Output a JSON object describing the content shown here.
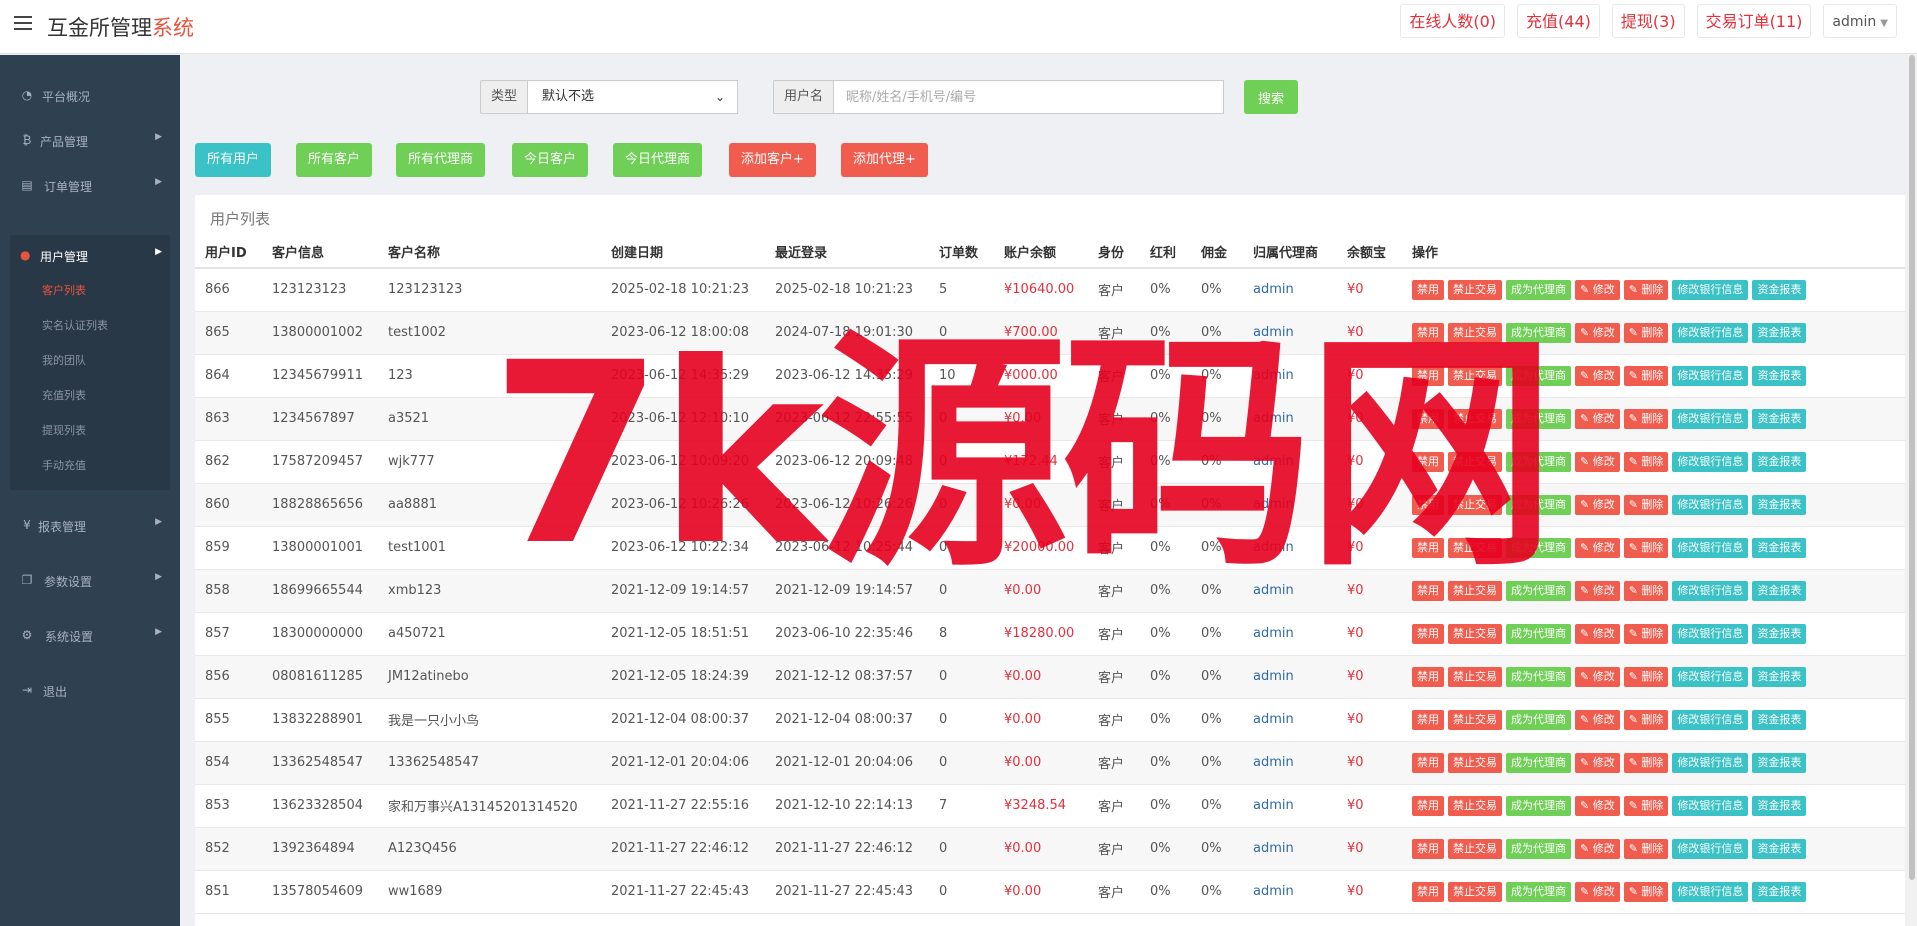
{
  "brand": {
    "title": "互金所管理",
    "accent": "系统"
  },
  "topbar": {
    "badges": [
      "在线人数(0)",
      "充值(44)",
      "提现(3)",
      "交易订单(11)"
    ],
    "user": "admin"
  },
  "sidebar": {
    "items": [
      {
        "label": "平台概况",
        "icon": "dashboard-icon"
      },
      {
        "label": "产品管理",
        "icon": "bitcoin-icon"
      },
      {
        "label": "订单管理",
        "icon": "orders-icon"
      },
      {
        "label": "用户管理",
        "icon": "user-icon"
      },
      {
        "label": "报表管理",
        "icon": "yen-icon"
      },
      {
        "label": "参数设置",
        "icon": "params-icon"
      },
      {
        "label": "系统设置",
        "icon": "gear-icon"
      },
      {
        "label": "退出",
        "icon": "logout-icon"
      }
    ],
    "sub_items": [
      "客户列表",
      "实名认证列表",
      "我的团队",
      "充值列表",
      "提现列表",
      "手动充值"
    ]
  },
  "search": {
    "type_label": "类型",
    "type_value": "默认不选",
    "user_label": "用户名",
    "user_placeholder": "昵称/姓名/手机号/编号",
    "button": "搜索"
  },
  "actions": [
    "所有用户",
    "所有客户",
    "所有代理商",
    "今日客户",
    "今日代理商",
    "添加客户+",
    "添加代理+"
  ],
  "colors": {
    "teal": "#3bc2c6",
    "green": "#6fcf57",
    "red": "#f05d4f",
    "brand_accent": "#e8543e",
    "sidebar": "#2f4050"
  },
  "panel_title": "用户列表",
  "table": {
    "headers": [
      "用户ID",
      "客户信息",
      "客户名称",
      "创建日期",
      "最近登录",
      "订单数",
      "账户余额",
      "身份",
      "红利",
      "佣金",
      "归属代理商",
      "余额宝",
      "操作"
    ],
    "ops": [
      "禁用",
      "禁止交易",
      "成为代理商",
      "✎ 修改",
      "✎ 删除",
      "修改银行信息",
      "资金报表"
    ],
    "rows": [
      [
        "866",
        "123123123",
        "123123123",
        "2025-02-18 10:21:23",
        "2025-02-18 10:21:23",
        "5",
        "¥10640.00",
        "客户",
        "0%",
        "0%",
        "admin",
        "¥0"
      ],
      [
        "865",
        "13800001002",
        "test1002",
        "2023-06-12 18:00:08",
        "2024-07-18 19:01:30",
        "0",
        "¥700.00",
        "客户",
        "0%",
        "0%",
        "admin",
        "¥0"
      ],
      [
        "864",
        "12345679911",
        "123",
        "2023-06-12 14:35:29",
        "2023-06-12 14:35:29",
        "10",
        "¥000.00",
        "客户",
        "0%",
        "0%",
        "admin",
        "¥0"
      ],
      [
        "863",
        "1234567897",
        "a3521",
        "2023-06-12 12:10:10",
        "2023-06-12 22:55:55",
        "0",
        "¥0.00",
        "客户",
        "0%",
        "0%",
        "admin",
        "¥0"
      ],
      [
        "862",
        "17587209457",
        "wjk777",
        "2023-06-12 10:09:20",
        "2023-06-12 20:09:48",
        "0",
        "¥172.44",
        "客户",
        "0%",
        "0%",
        "admin",
        "¥0"
      ],
      [
        "860",
        "18828865656",
        "aa8881",
        "2023-06-12 10:26:26",
        "2023-06-12 10:26:26",
        "0",
        "¥0.00",
        "客户",
        "0%",
        "0%",
        "admin",
        "¥0"
      ],
      [
        "859",
        "13800001001",
        "test1001",
        "2023-06-12 10:22:34",
        "2023-06-12 10:25:44",
        "0",
        "¥20000.00",
        "客户",
        "0%",
        "0%",
        "admin",
        "¥0"
      ],
      [
        "858",
        "18699665544",
        "xmb123",
        "2021-12-09 19:14:57",
        "2021-12-09 19:14:57",
        "0",
        "¥0.00",
        "客户",
        "0%",
        "0%",
        "admin",
        "¥0"
      ],
      [
        "857",
        "18300000000",
        "a450721",
        "2021-12-05 18:51:51",
        "2023-06-10 22:35:46",
        "8",
        "¥18280.00",
        "客户",
        "0%",
        "0%",
        "admin",
        "¥0"
      ],
      [
        "856",
        "08081611285",
        "JM12atinebo",
        "2021-12-05 18:24:39",
        "2021-12-12 08:37:57",
        "0",
        "¥0.00",
        "客户",
        "0%",
        "0%",
        "admin",
        "¥0"
      ],
      [
        "855",
        "13832288901",
        "我是一只小小鸟",
        "2021-12-04 08:00:37",
        "2021-12-04 08:00:37",
        "0",
        "¥0.00",
        "客户",
        "0%",
        "0%",
        "admin",
        "¥0"
      ],
      [
        "854",
        "13362548547",
        "13362548547",
        "2021-12-01 20:04:06",
        "2021-12-01 20:04:06",
        "0",
        "¥0.00",
        "客户",
        "0%",
        "0%",
        "admin",
        "¥0"
      ],
      [
        "853",
        "13623328504",
        "家和万事兴A13145201314520",
        "2021-11-27 22:55:16",
        "2021-12-10 22:14:13",
        "7",
        "¥3248.54",
        "客户",
        "0%",
        "0%",
        "admin",
        "¥0"
      ],
      [
        "852",
        "1392364894",
        "A123Q456",
        "2021-11-27 22:46:12",
        "2021-11-27 22:46:12",
        "0",
        "¥0.00",
        "客户",
        "0%",
        "0%",
        "admin",
        "¥0"
      ],
      [
        "851",
        "13578054609",
        "ww1689",
        "2021-11-27 22:45:43",
        "2021-11-27 22:45:43",
        "0",
        "¥0.00",
        "客户",
        "0%",
        "0%",
        "admin",
        "¥0"
      ]
    ]
  },
  "watermark": "7k源码网"
}
